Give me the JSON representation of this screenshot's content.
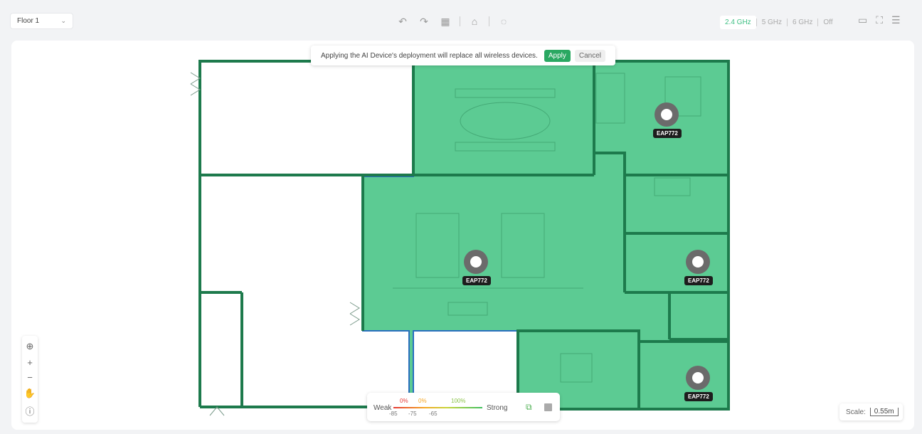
{
  "toolbar": {
    "floor_selector": "Floor 1",
    "bands": [
      {
        "label": "2.4 GHz",
        "active": true
      },
      {
        "label": "5 GHz",
        "active": false
      },
      {
        "label": "6 GHz",
        "active": false
      },
      {
        "label": "Off",
        "active": false
      }
    ],
    "icons": [
      "undo-icon",
      "redo-icon",
      "grid-icon",
      "device-icon",
      "signal-icon",
      "ruler-icon",
      "fullscreen-icon",
      "settings-icon"
    ]
  },
  "banner": {
    "message": "Applying the AI Device's deployment will replace all wireless devices.",
    "apply_label": "Apply",
    "cancel_label": "Cancel"
  },
  "access_points": [
    {
      "label": "EAP772"
    },
    {
      "label": "EAP772"
    },
    {
      "label": "EAP772"
    },
    {
      "label": "EAP772"
    }
  ],
  "legend": {
    "weak_label": "Weak",
    "strong_label": "Strong",
    "percents": [
      "0%",
      "0%",
      "100%"
    ],
    "levels": [
      "-85",
      "-75",
      "-65"
    ]
  },
  "scale": {
    "label": "Scale:",
    "value": "0.55m"
  },
  "colors": {
    "coverage": "#5ccb93",
    "wall": "#1d7a4c",
    "accent": "#2aa862"
  }
}
